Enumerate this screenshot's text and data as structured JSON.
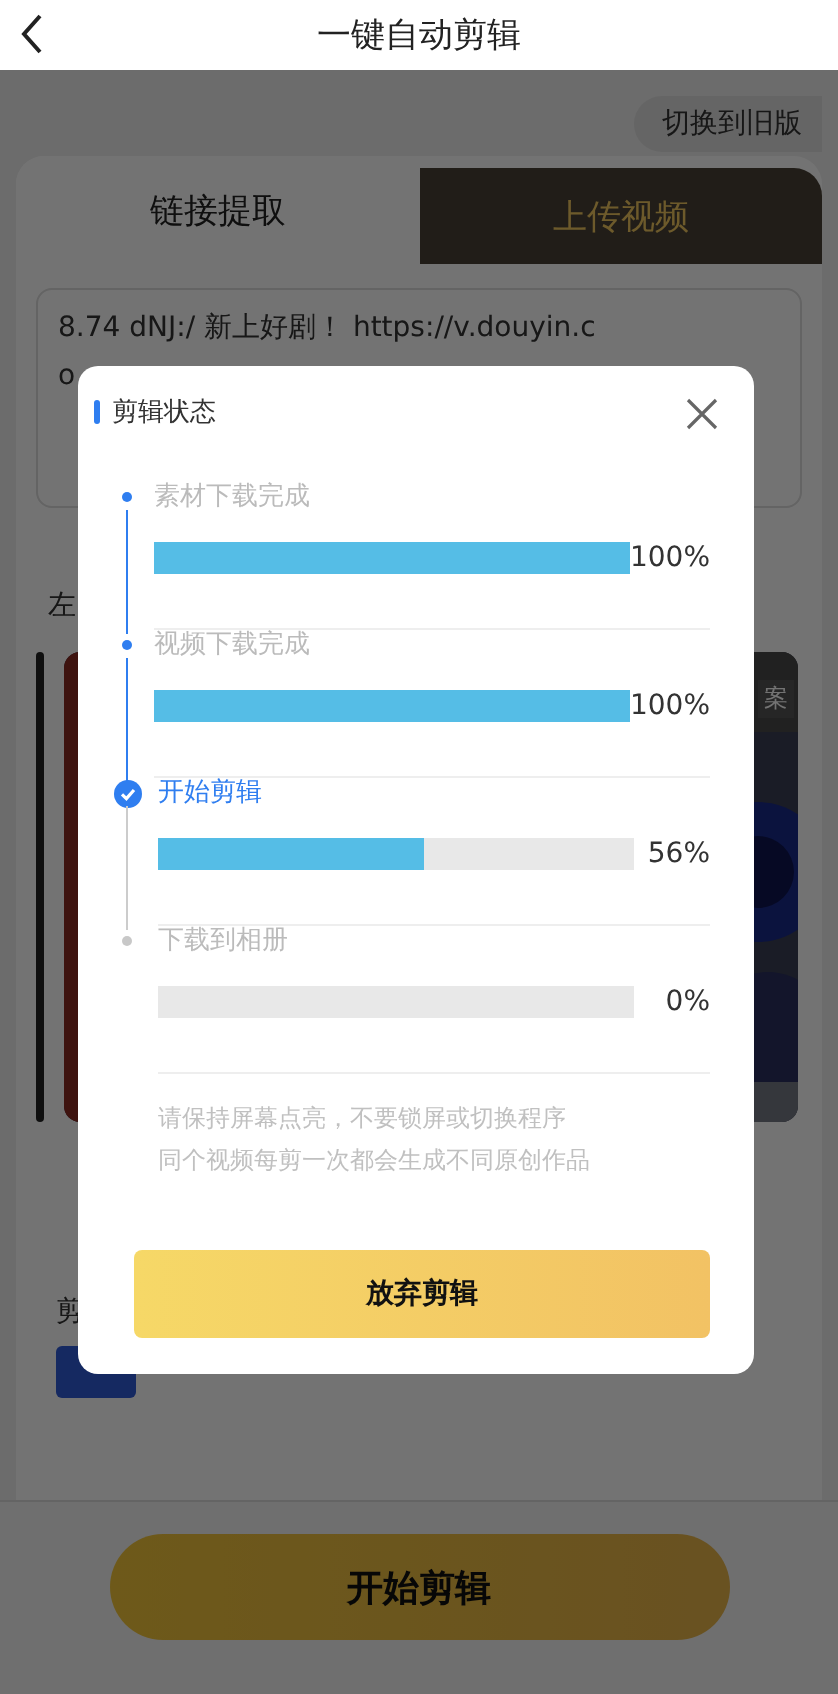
{
  "header": {
    "title": "一键自动剪辑"
  },
  "switch_button": "切换到旧版",
  "tabs": [
    {
      "label": "链接提取",
      "selected": true
    },
    {
      "label": "上传视频",
      "selected": false
    }
  ],
  "link_text": [
    "8.74 dNJ:/ 新上好剧！  https://v.douyin.c",
    "o"
  ],
  "section_label": "左",
  "video_tag": "案",
  "edit_label": "剪",
  "start_button": "开始剪辑",
  "dialog": {
    "title": "剪辑状态",
    "steps": [
      {
        "label": "素材下载完成",
        "kind": "done",
        "level": 1,
        "reading": "100%"
      },
      {
        "label": "视频下载完成",
        "kind": "done",
        "level": 1,
        "reading": "100%"
      },
      {
        "label": "开始剪辑",
        "kind": "current",
        "level": 0.56,
        "reading": "56%"
      },
      {
        "label": "下载到相册",
        "kind": "pending",
        "level": 0,
        "reading": "0%"
      }
    ],
    "notes": [
      "请保持屏幕点亮，不要锁屏或切换程序",
      "同个视频每剪一次都会生成不同原创作品"
    ],
    "button": "放弃剪辑"
  }
}
